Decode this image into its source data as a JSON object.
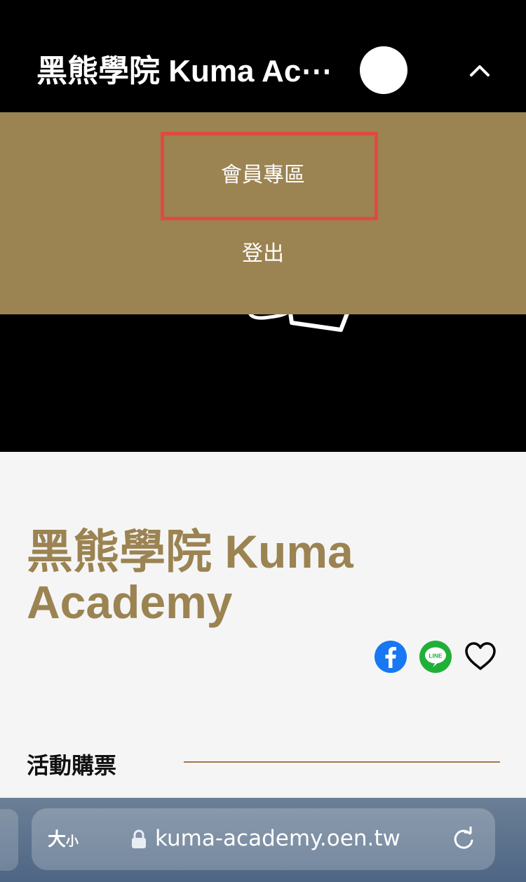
{
  "header": {
    "title": "黑熊學院 Kuma Ac⋯"
  },
  "menu": {
    "items": [
      {
        "label": "會員專區"
      },
      {
        "label": "登出"
      }
    ]
  },
  "page": {
    "title": "黑熊學院 Kuma Academy",
    "section_label": "活動購票"
  },
  "share": {
    "icons": [
      "facebook-icon",
      "line-icon",
      "heart-icon"
    ],
    "line_text": "LINE"
  },
  "browser": {
    "text_size_large": "大",
    "text_size_small": "小",
    "url": "kuma-academy.oen.tw"
  },
  "colors": {
    "brand_gold": "#9b8352",
    "highlight_red": "#e04a3e",
    "facebook_blue": "#1877f2",
    "line_green": "#20b038"
  }
}
